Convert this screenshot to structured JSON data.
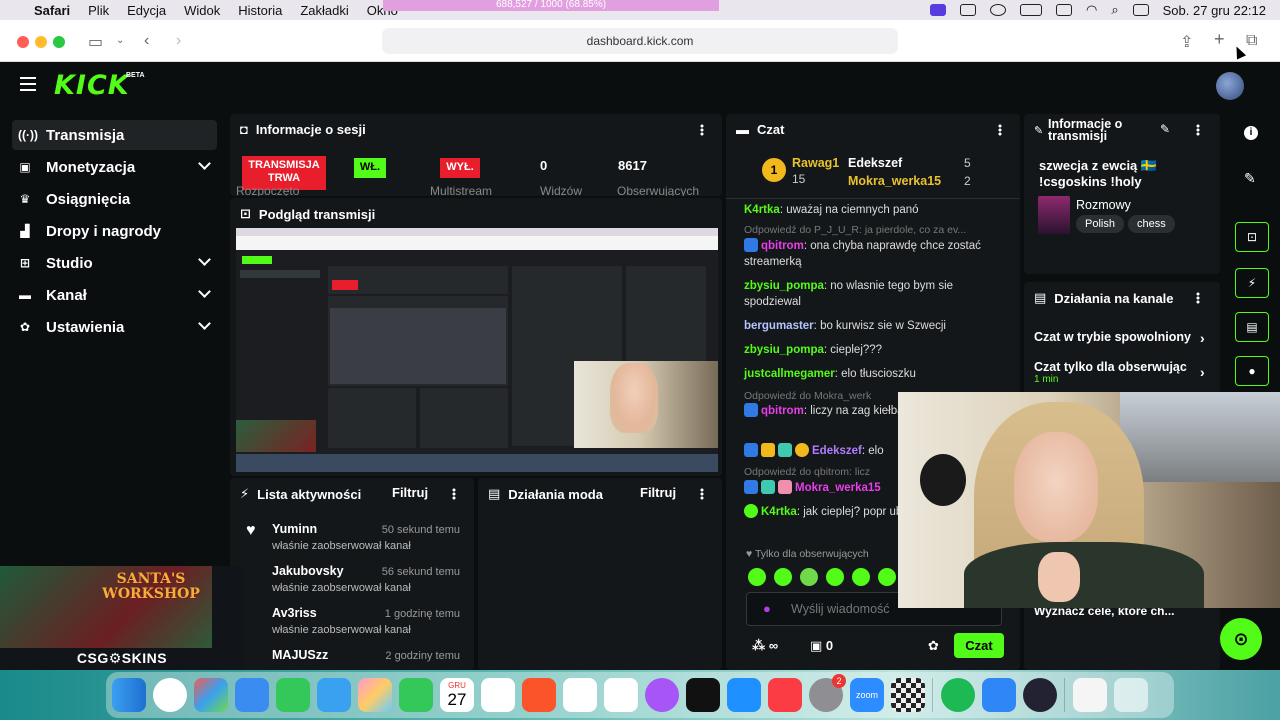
{
  "menubar": {
    "apple": "",
    "app": "Safari",
    "items": [
      "Plik",
      "Edycja",
      "Widok",
      "Historia",
      "Zakładki",
      "Okno"
    ],
    "center_progress": "688,527 / 1000 (68.85%)",
    "datetime": "Sob. 27 gru  22:12"
  },
  "browser": {
    "url": "dashboard.kick.com"
  },
  "kick": {
    "logo": "KICK",
    "beta": "BETA"
  },
  "sidebar": {
    "items": [
      {
        "label": "Transmisja",
        "icon": "broadcast-icon"
      },
      {
        "label": "Monetyzacja",
        "icon": "wallet-icon"
      },
      {
        "label": "Osiągnięcia",
        "icon": "trophy-icon"
      },
      {
        "label": "Dropy i nagrody",
        "icon": "gift-icon"
      },
      {
        "label": "Studio",
        "icon": "studio-icon"
      },
      {
        "label": "Kanał",
        "icon": "channel-icon"
      },
      {
        "label": "Ustawienia",
        "icon": "gear-icon"
      }
    ]
  },
  "session": {
    "title": "Informacje o sesji",
    "badge_live": "TRANSMISJA TRWA",
    "badge_on": "WŁ.",
    "badge_off": "WYŁ.",
    "viewers": "0",
    "followers": "8617",
    "viewers_label": "Widzów",
    "followers_label": "Obserwujących",
    "cut_label_1": "Rozpoczęto",
    "cut_label_2": "Multistream"
  },
  "preview": {
    "title": "Podgląd transmisji"
  },
  "activity": {
    "title": "Lista aktywności",
    "filter": "Filtruj",
    "rows": [
      {
        "name": "Yuminn",
        "time": "50 sekund temu",
        "desc": "właśnie zaobserwował kanał"
      },
      {
        "name": "Jakubovsky",
        "time": "56 sekund temu",
        "desc": "właśnie zaobserwował kanał"
      },
      {
        "name": "Av3riss",
        "time": "1 godzinę temu",
        "desc": "właśnie zaobserwował kanał"
      },
      {
        "name": "MAJUSzz",
        "time": "2 godziny temu",
        "desc": ""
      }
    ]
  },
  "mod": {
    "title": "Działania moda",
    "filter": "Filtruj"
  },
  "chat": {
    "title": "Czat",
    "leaders": [
      {
        "name": "Rawag1",
        "num": "15"
      },
      {
        "name": "Edekszef",
        "num": "5"
      },
      {
        "name": "Mokra_werka15",
        "num": "2"
      }
    ],
    "messages": [
      {
        "type": "msg",
        "user": "K4rtka",
        "text": "uważaj na ciemnych panó"
      },
      {
        "type": "reply",
        "text": "Odpowiedź do P_J_U_R: ja pierdole, co za ev..."
      },
      {
        "type": "msg",
        "user": "qbitrom",
        "text": "ona chyba naprawdę chce zostać streamerką"
      },
      {
        "type": "msg",
        "user": "zbysiu_pompa",
        "text": "no wlasnie tego bym sie spodziewal"
      },
      {
        "type": "msg",
        "user": "bergumaster",
        "text": "bo kurwisz sie w Szwecji"
      },
      {
        "type": "msg",
        "user": "zbysiu_pompa",
        "text": "cieplej???"
      },
      {
        "type": "msg",
        "user": "justcallmegamer",
        "text": "elo tłuscioszku"
      },
      {
        "type": "reply",
        "text": "Odpowiedź do Mokra_werk"
      },
      {
        "type": "msg",
        "user": "qbitrom",
        "text": "liczy na zag kiełbaskę??"
      },
      {
        "type": "msg",
        "user": "Edekszef",
        "text": "elo"
      },
      {
        "type": "reply",
        "text": "Odpowiedź do qbitrom: licz"
      },
      {
        "type": "msg",
        "user": "Mokra_werka15",
        "text": ""
      },
      {
        "type": "msg",
        "user": "K4rtka",
        "text": "jak cieplej? popr ubierasz"
      }
    ],
    "followers_only": "Tylko dla obserwujących",
    "placeholder": "Wyślij wiadomość",
    "count": "0",
    "send": "Czat"
  },
  "info": {
    "title": "Informacje o transmisji",
    "stream_title": "szwecja z ewcią 🇸🇪 !csgoskins !holy",
    "category": "Rozmowy",
    "tags": [
      "Polish",
      "chess"
    ]
  },
  "channel_actions": {
    "title": "Działania na kanale",
    "items": [
      {
        "label": "Czat w trybie spowolniony",
        "sub": ""
      },
      {
        "label": "Czat tylko dla obserwując",
        "sub": "1 min"
      }
    ],
    "bottom": "Wyznacz cele, które ch..."
  },
  "csgo": {
    "banner": "SANTA'S WORKSHOP",
    "logo": "CSG⚙SKINS"
  },
  "dock": {
    "cal_month": "GRU",
    "cal_day": "27",
    "badge": "2",
    "zoom": "zoom"
  },
  "colors": {
    "kick_green": "#53fc18",
    "live_red": "#e81e2c",
    "panel": "#141719",
    "bg": "#0b0e0f"
  }
}
